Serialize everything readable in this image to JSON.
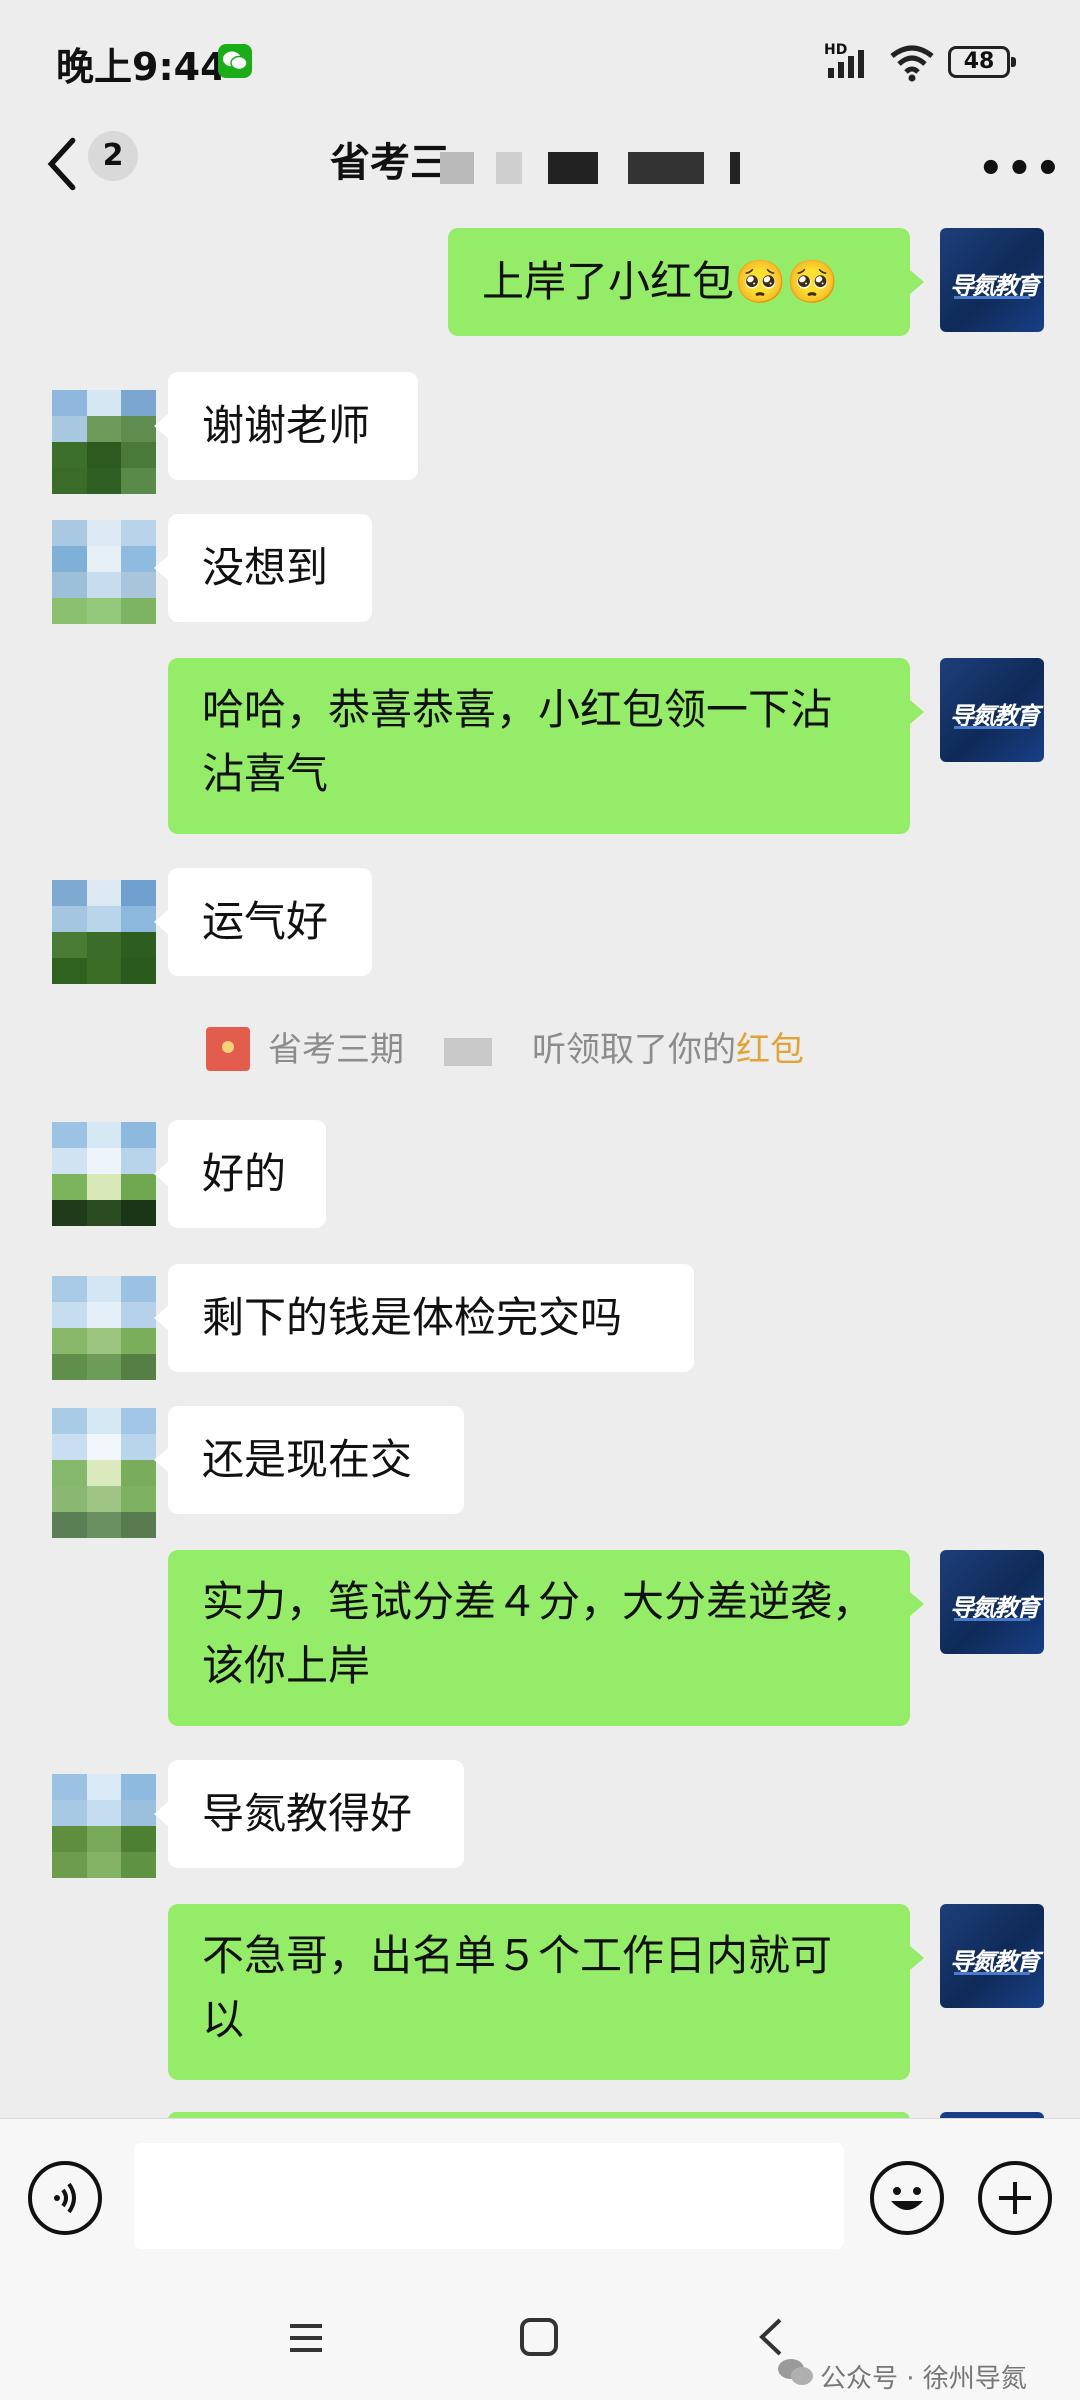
{
  "status_bar": {
    "time": "晚上9:44",
    "hd": "HD",
    "battery": "48"
  },
  "header": {
    "unread_count": "2",
    "title": "省考三"
  },
  "messages": [
    {
      "side": "right",
      "text": "上岸了小红包🥺🥺"
    },
    {
      "side": "left",
      "text": "谢谢老师"
    },
    {
      "side": "left",
      "text": "没想到"
    },
    {
      "side": "right",
      "line1": "哈哈，恭喜恭喜，小红包领一下沾",
      "line2": "沾喜气"
    },
    {
      "side": "left",
      "text": "运气好"
    },
    {
      "side": "left",
      "text": "好的"
    },
    {
      "side": "left",
      "text": "剩下的钱是体检完交吗"
    },
    {
      "side": "left",
      "text": "还是现在交"
    },
    {
      "side": "right",
      "line1": "实力，笔试分差４分，大分差逆袭，",
      "line2": "该你上岸"
    },
    {
      "side": "left",
      "text": "导氮教得好"
    },
    {
      "side": "right",
      "line1": "不急哥，出名单５个工作日内就可",
      "line2": "以"
    }
  ],
  "system_message": {
    "prefix": "省考三期",
    "middle": "听领取了你的",
    "highlight": "红包"
  },
  "brand_avatar": {
    "logo_text": "导氮教育"
  },
  "watermark": "公众号 · 徐州导氮",
  "colors": {
    "chat_bg": "#ededed",
    "my_bubble": "#95ec69",
    "their_bubble": "#ffffff",
    "highlight": "#e1a337"
  },
  "icons": [
    "back-icon",
    "more-icon",
    "voice-icon",
    "emoji-icon",
    "plus-icon",
    "menu-icon",
    "home-icon",
    "back-nav-icon",
    "red-packet-icon"
  ]
}
